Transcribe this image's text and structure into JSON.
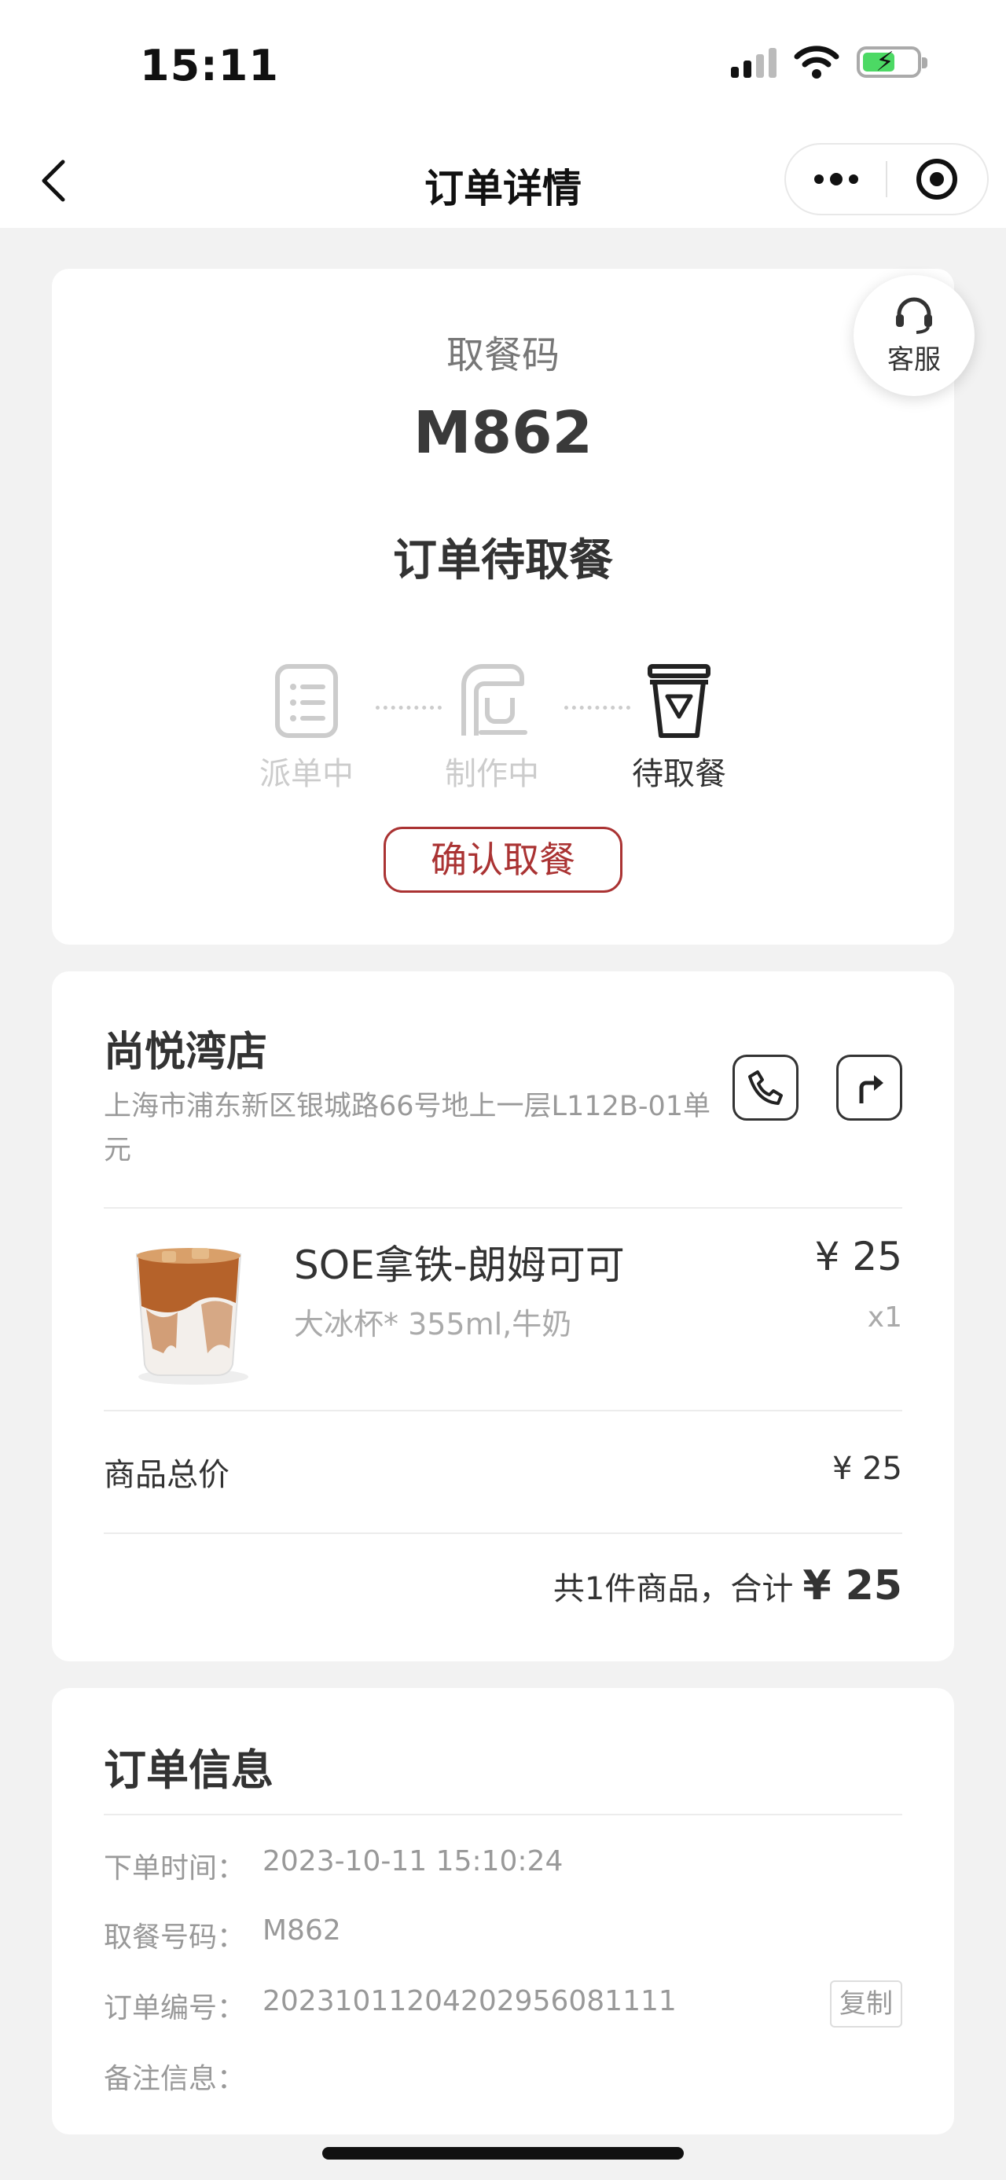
{
  "status_bar": {
    "time": "15:11"
  },
  "nav": {
    "title": "订单详情"
  },
  "service": {
    "label": "客服"
  },
  "pickup": {
    "label": "取餐码",
    "code": "M862",
    "status": "订单待取餐",
    "steps": [
      {
        "label": "派单中",
        "icon": "list-icon",
        "active": false
      },
      {
        "label": "制作中",
        "icon": "coffee-machine-icon",
        "active": false
      },
      {
        "label": "待取餐",
        "icon": "cup-icon",
        "active": true
      }
    ],
    "confirm_label": "确认取餐",
    "accent_color": "#aa3333"
  },
  "store": {
    "name": "尚悦湾店",
    "address": "上海市浦东新区银城路66号地上一层L112B-01单元"
  },
  "product": {
    "name": "SOE拿铁-朗姆可可",
    "spec": "大冰杯* 355ml,牛奶",
    "price": "¥ 25",
    "qty": "x1"
  },
  "summary": {
    "subtotal_label": "商品总价",
    "subtotal_value": "¥ 25",
    "total_prefix": "共1件商品，合计",
    "total_value": "¥ 25"
  },
  "order_info": {
    "title": "订单信息",
    "rows": [
      {
        "key": "下单时间：",
        "value": "2023-10-11 15:10:24"
      },
      {
        "key": "取餐号码：",
        "value": "M862"
      },
      {
        "key": "订单编号：",
        "value": "20231011204202956081111"
      },
      {
        "key": "备注信息：",
        "value": ""
      }
    ],
    "copy_label": "复制"
  }
}
